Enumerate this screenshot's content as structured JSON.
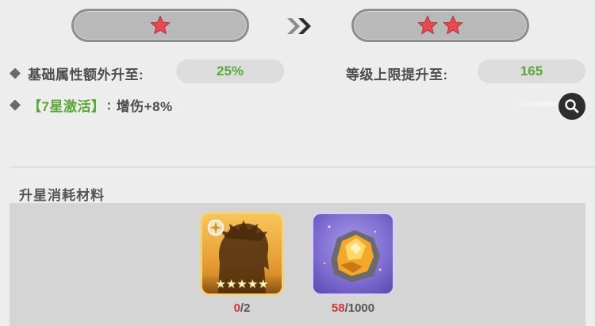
{
  "upgrade": {
    "current_stars": 1,
    "next_stars": 2,
    "star_color": "#e84a52",
    "arrow_icon": "double-chevron-right-icon"
  },
  "attributes": {
    "base_bonus_label": "基础属性额外升至:",
    "base_bonus_value": "25%",
    "level_cap_label": "等级上限提升至:",
    "level_cap_value": "165",
    "activation_tag": "【7星激活】",
    "activation_sep": ":",
    "activation_effect": "增伤+8%",
    "value_color": "#5aa838"
  },
  "materials": {
    "title": "升星消耗材料",
    "items": [
      {
        "icon": "character-shard-icon",
        "have": "0",
        "need": "/2",
        "rarity": "★★★★★"
      },
      {
        "icon": "gold-crystal-icon",
        "have": "58",
        "need": "/1000"
      }
    ]
  },
  "search_icon": "magnifier-icon"
}
